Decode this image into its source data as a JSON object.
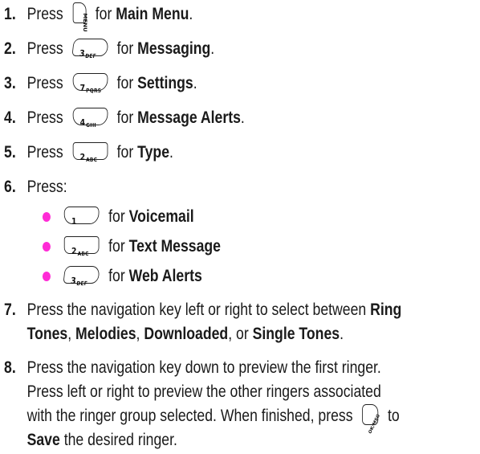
{
  "steps": [
    {
      "num": "1.",
      "pre": "Press",
      "key": "MENU",
      "mid": "for",
      "bold": "Main Menu",
      "post": "."
    },
    {
      "num": "2.",
      "pre": "Press",
      "key_main": "3",
      "key_sub": "DEF",
      "mid": "for",
      "bold": "Messaging",
      "post": "."
    },
    {
      "num": "3.",
      "pre": "Press",
      "key_main": "7",
      "key_sub": "PQRS",
      "mid": "for",
      "bold": "Settings",
      "post": "."
    },
    {
      "num": "4.",
      "pre": "Press",
      "key_main": "4",
      "key_sub": "GHI",
      "mid": "for",
      "bold": "Message Alerts",
      "post": "."
    },
    {
      "num": "5.",
      "pre": "Press",
      "key_main": "2",
      "key_sub": "ABC",
      "mid": "for",
      "bold": "Type",
      "post": "."
    },
    {
      "num": "6.",
      "text": "Press:"
    },
    {
      "num": "7.",
      "text_a": "Press the navigation key left or right to select between ",
      "bold_a": "Ring",
      "bold_b": "Tones",
      "sep1": ", ",
      "bold_c": "Melodies",
      "sep2": ", ",
      "bold_d": "Downloaded",
      "sep3": ", or ",
      "bold_e": "Single Tones",
      "end": "."
    },
    {
      "num": "8.",
      "line1": "Press the navigation key down to preview the first ringer.",
      "line2": "Press left or right to preview the other ringers associated",
      "line3_pre": "with the ringer group selected. When finished, press",
      "line3_key": "OK/MSG",
      "line3_post": "to",
      "line4_bold": "Save",
      "line4_rest": " the desired ringer."
    }
  ],
  "bullets": [
    {
      "key_main": "1",
      "key_sub": "",
      "mid": "for",
      "bold": "Voicemail"
    },
    {
      "key_main": "2",
      "key_sub": "ABC",
      "mid": "for",
      "bold": "Text Message"
    },
    {
      "key_main": "3",
      "key_sub": "DEF",
      "mid": "for",
      "bold": "Web Alerts"
    }
  ],
  "colors": {
    "bullet": "#ff2bd6",
    "text": "#1a1a1a"
  },
  "icons": [
    "menu-key-icon",
    "key-3-icon",
    "key-7-icon",
    "key-4-icon",
    "key-2-icon",
    "key-1-icon",
    "ok-key-icon"
  ]
}
